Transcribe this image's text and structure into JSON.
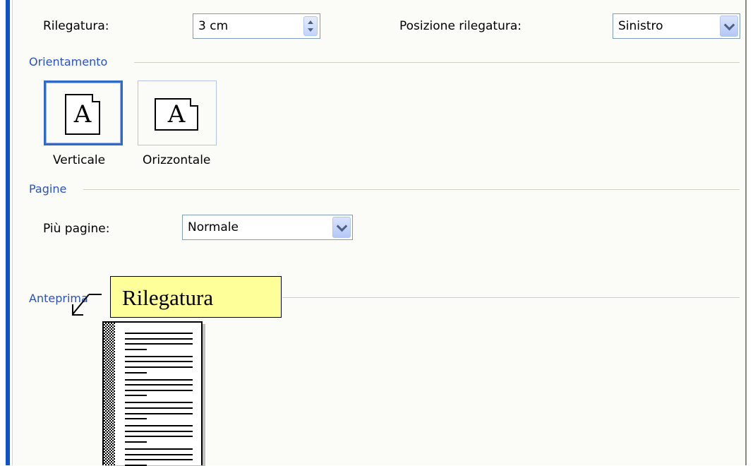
{
  "binding": {
    "gutter_label": "Rilegatura:",
    "gutter_value": "3 cm",
    "position_label": "Posizione rilegatura:",
    "position_value": "Sinistro"
  },
  "orientation": {
    "title": "Orientamento",
    "portrait_label": "Verticale",
    "landscape_label": "Orizzontale",
    "icon_letter": "A",
    "selected": "Verticale"
  },
  "pages": {
    "title": "Pagine",
    "multiple_label": "Più pagine:",
    "multiple_value": "Normale"
  },
  "preview": {
    "title": "Anteprima"
  },
  "tooltip": {
    "text": "Rilegatura"
  },
  "colors": {
    "group_title": "#2a52be",
    "selected_border": "#316ac5",
    "tooltip_bg": "#ffff99",
    "window_frame": "#0f52c6"
  }
}
